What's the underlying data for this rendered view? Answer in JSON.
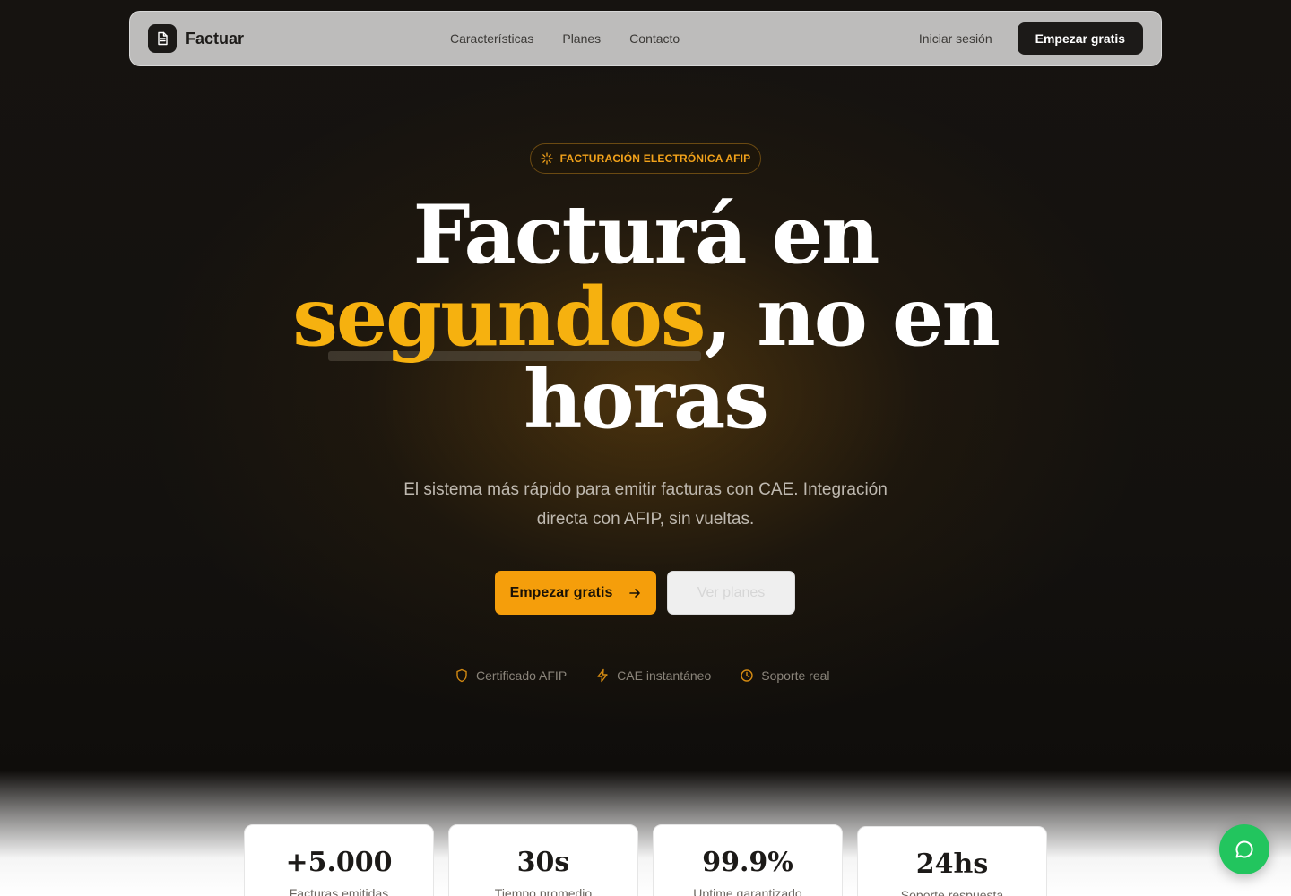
{
  "nav": {
    "brand": "Factuar",
    "links": [
      "Características",
      "Planes",
      "Contacto"
    ],
    "login": "Iniciar sesión",
    "cta": "Empezar gratis"
  },
  "hero": {
    "badge": "FACTURACIÓN ELECTRÓNICA AFIP",
    "title_part1": "Facturá en",
    "title_highlight": "segundos",
    "title_part2": ", no en",
    "title_part3": "horas",
    "subtitle": "El sistema más rápido para emitir facturas con CAE. Integración directa con AFIP, sin vueltas.",
    "primary_cta": "Empezar gratis",
    "secondary_cta": "Ver planes",
    "trust": [
      "Certificado AFIP",
      "CAE instantáneo",
      "Soporte real"
    ]
  },
  "stats": [
    {
      "value": "+5.000",
      "label": "Facturas emitidas"
    },
    {
      "value": "30s",
      "label": "Tiempo promedio"
    },
    {
      "value": "99.9%",
      "label": "Uptime garantizado"
    },
    {
      "value": "24hs",
      "label": "Soporte respuesta"
    }
  ],
  "colors": {
    "accent": "#f59e0b",
    "highlight": "#f6b10f",
    "chat": "#22c55e",
    "dark": "#1c1a18"
  },
  "icons": {
    "logo": "document-icon",
    "badge": "sparkle-icon",
    "arrow": "arrow-right-icon",
    "trust": [
      "shield-icon",
      "lightning-icon",
      "clock-icon"
    ],
    "chat": "chat-bubble-icon"
  }
}
